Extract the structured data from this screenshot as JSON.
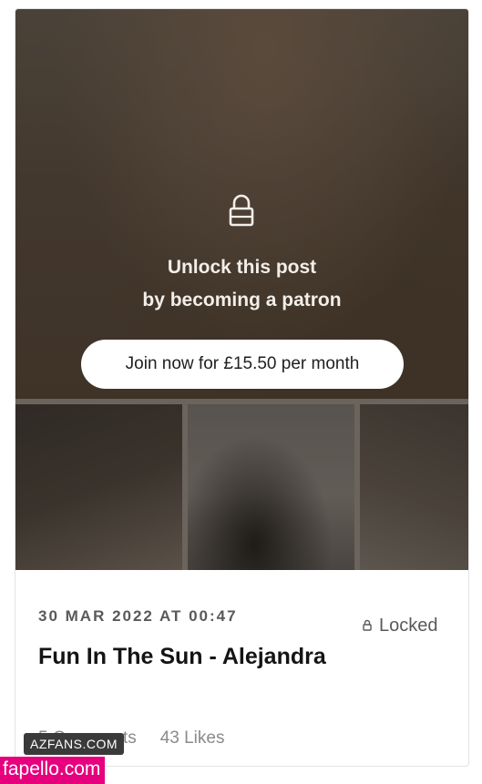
{
  "gate": {
    "line1": "Unlock this post",
    "line2": "by becoming a patron",
    "join_label": "Join now for £15.50 per month",
    "lock_icon": "lock-icon"
  },
  "thumbnails": [
    "blurred-thumbnail",
    "blurred-thumbnail",
    "blurred-thumbnail"
  ],
  "post": {
    "date": "30 MAR 2022 AT 00:47",
    "status": "Locked",
    "status_icon": "small-lock-icon",
    "title": "Fun In The Sun - Alejandra",
    "comments": "5 Comments",
    "likes": "43 Likes"
  },
  "watermarks": {
    "azfans": "AZFANS.COM",
    "fapello": "fapello.com"
  },
  "colors": {
    "button_bg": "#ffffff",
    "title_text": "#141414",
    "meta_text": "#595959",
    "fapello_pink": "#e6007e"
  }
}
